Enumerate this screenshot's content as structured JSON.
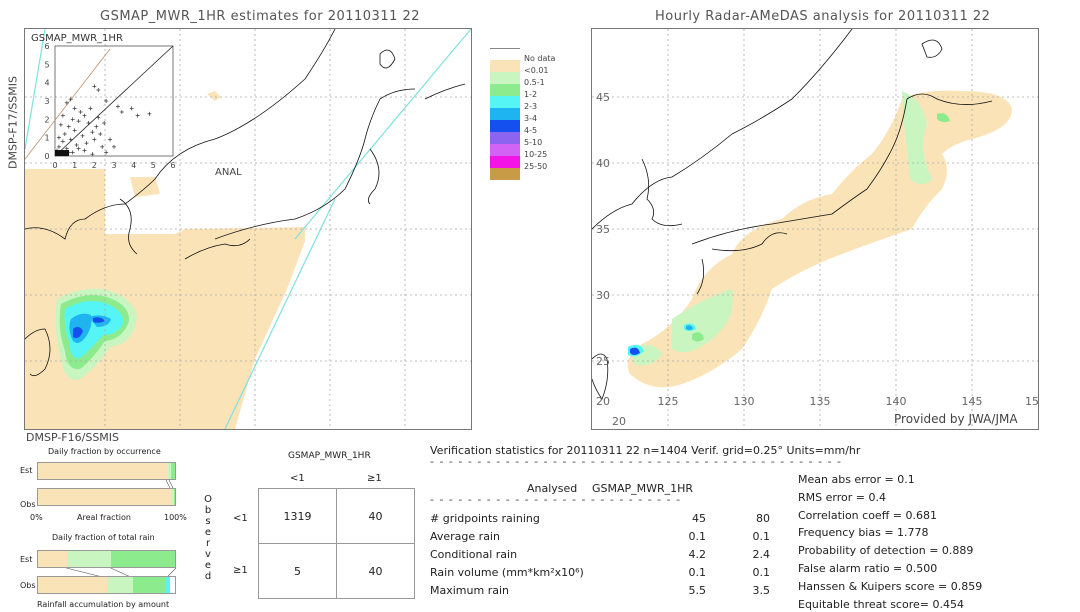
{
  "left_panel": {
    "title": "GSMAP_MWR_1HR estimates for 20110311 22",
    "satellite_top": "DMSP-F17/SSMIS",
    "satellite_bottom": "DMSP-F16/SSMIS",
    "anal_label": "ANAL"
  },
  "right_panel": {
    "title": "Hourly Radar-AMeDAS analysis for 20110311 22",
    "credit": "Provided by JWA/JMA",
    "lat_labels": [
      "45",
      "40",
      "35",
      "30",
      "25",
      "20"
    ],
    "lon_labels": [
      "125",
      "130",
      "135",
      "140",
      "145",
      "15"
    ]
  },
  "legend": [
    {
      "label": "No data",
      "color": "#FFFFFF"
    },
    {
      "label": "<0.01",
      "color": "#FBE3B8"
    },
    {
      "label": "0.5-1",
      "color": "#C8F5C0"
    },
    {
      "label": "1-2",
      "color": "#8CEB8C"
    },
    {
      "label": "2-3",
      "color": "#55F5F5"
    },
    {
      "label": "3-4",
      "color": "#1EB4F0"
    },
    {
      "label": "4-5",
      "color": "#1450F0"
    },
    {
      "label": "5-10",
      "color": "#8C64F0"
    },
    {
      "label": "10-25",
      "color": "#D264F5"
    },
    {
      "label": "25-50",
      "color": "#F514E6"
    },
    {
      "label": "",
      "color": "#C89B46"
    }
  ],
  "chart_data": [
    {
      "type": "scatter",
      "title": "GSMAP_MWR_1HR",
      "xlabel": "ANAL",
      "ylabel": "GSMAP_MWR_1HR",
      "xlim": [
        0,
        6
      ],
      "ylim": [
        0,
        6
      ],
      "x_ticks": [
        "0",
        "1",
        "2",
        "3",
        "4",
        "5",
        "6"
      ],
      "y_ticks": [
        "0",
        "1",
        "2",
        "3",
        "4",
        "5",
        "6"
      ],
      "points": [
        [
          0.1,
          0.3
        ],
        [
          0.2,
          0.5
        ],
        [
          0.3,
          0.2
        ],
        [
          0.4,
          0.8
        ],
        [
          0.5,
          1.2
        ],
        [
          0.6,
          0.4
        ],
        [
          0.7,
          1.6
        ],
        [
          0.8,
          0.9
        ],
        [
          0.9,
          2.0
        ],
        [
          1.0,
          1.4
        ],
        [
          1.1,
          0.6
        ],
        [
          1.2,
          1.9
        ],
        [
          1.3,
          2.4
        ],
        [
          1.4,
          1.1
        ],
        [
          1.5,
          2.2
        ],
        [
          1.6,
          0.7
        ],
        [
          1.7,
          1.8
        ],
        [
          1.8,
          2.6
        ],
        [
          1.9,
          1.3
        ],
        [
          2.0,
          0.9
        ],
        [
          2.1,
          1.6
        ],
        [
          2.2,
          2.1
        ],
        [
          2.3,
          1.2
        ],
        [
          2.4,
          0.5
        ],
        [
          0.2,
          1.0
        ],
        [
          0.4,
          2.2
        ],
        [
          0.6,
          2.9
        ],
        [
          0.8,
          3.1
        ],
        [
          1.0,
          2.6
        ],
        [
          0.3,
          1.7
        ],
        [
          2.5,
          1.8
        ],
        [
          2.8,
          0.9
        ],
        [
          3.2,
          2.7
        ],
        [
          3.4,
          2.4
        ],
        [
          3.9,
          2.6
        ],
        [
          4.2,
          2.2
        ],
        [
          4.8,
          2.3
        ],
        [
          2.6,
          3.0
        ],
        [
          2.2,
          3.6
        ],
        [
          2.0,
          3.8
        ],
        [
          0.5,
          0.1
        ],
        [
          0.9,
          0.2
        ],
        [
          1.5,
          0.3
        ],
        [
          1.9,
          0.1
        ],
        [
          2.6,
          0.2
        ],
        [
          1.2,
          0.4
        ],
        [
          0.2,
          0.1
        ],
        [
          0.1,
          0.1
        ],
        [
          3.0,
          0.5
        ],
        [
          0.7,
          0.2
        ]
      ],
      "reference_lines": [
        "1:1 diagonal",
        "regression line"
      ]
    },
    {
      "type": "bar",
      "title": "Daily fraction by occurrence",
      "xlabel": "Areal fraction",
      "x_ticks": [
        "0%",
        "100%"
      ],
      "categories": [
        "Est",
        "Obs"
      ],
      "series": [
        {
          "name": "<0.01",
          "values": [
            0.95,
            0.98
          ]
        },
        {
          "name": "0.5-1",
          "values": [
            0.02,
            0.01
          ]
        },
        {
          "name": "1-2",
          "values": [
            0.03,
            0.01
          ]
        }
      ]
    },
    {
      "type": "bar",
      "title": "Daily fraction of total rain",
      "xlabel": "Rainfall accumulation by amount",
      "categories": [
        "Est",
        "Obs"
      ],
      "series": [
        {
          "name": "<0.01",
          "values": [
            0.21,
            0.5
          ]
        },
        {
          "name": "0.5-1",
          "values": [
            0.32,
            0.19
          ]
        },
        {
          "name": "1-2",
          "values": [
            0.47,
            0.24
          ]
        },
        {
          "name": "2-3",
          "values": [
            0.0,
            0.03
          ]
        }
      ]
    },
    {
      "type": "table",
      "title": "Contingency table",
      "col_header": "GSMAP_MWR_1HR",
      "row_header": "Observed",
      "columns": [
        "<1",
        "≥1"
      ],
      "rows": [
        "<1",
        "≥1"
      ],
      "cells": [
        [
          "1319",
          "40"
        ],
        [
          "5",
          "40"
        ]
      ]
    }
  ],
  "verification": {
    "header": "Verification statistics for 20110311 22   n=1404   Verif. grid=0.25°   Units=mm/hr",
    "col_analysed": "Analysed",
    "col_gsmap": "GSMAP_MWR_1HR",
    "rows": [
      {
        "label": "# gridpoints raining",
        "analysed": "45",
        "gsmap": "80"
      },
      {
        "label": "Average rain",
        "analysed": "0.1",
        "gsmap": "0.1"
      },
      {
        "label": "Conditional rain",
        "analysed": "4.2",
        "gsmap": "2.4"
      },
      {
        "label": "Rain volume (mm*km²x10⁶)",
        "analysed": "0.1",
        "gsmap": "0.1"
      },
      {
        "label": "Maximum rain",
        "analysed": "5.5",
        "gsmap": "3.5"
      }
    ],
    "scores": [
      "Mean abs error = 0.1",
      "RMS error = 0.4",
      "Correlation coeff = 0.681",
      "Frequency bias = 1.778",
      "Probability of detection = 0.889",
      "False alarm ratio = 0.500",
      "Hanssen & Kuipers score = 0.859",
      "Equitable threat score= 0.454"
    ]
  },
  "occurrence_chart": {
    "title": "Daily fraction by occurrence",
    "est_label": "Est",
    "obs_label": "Obs",
    "x_left": "0%",
    "x_mid": "Areal fraction",
    "x_right": "100%"
  },
  "rain_chart": {
    "title": "Daily fraction of total rain",
    "est_label": "Est",
    "obs_label": "Obs",
    "xlabel": "Rainfall accumulation by amount"
  },
  "contingency": {
    "col_header": "GSMAP_MWR_1HR",
    "col_lt": "<1",
    "col_ge": "≥1",
    "row_lt": "<1",
    "row_ge": "≥1",
    "observed_letters": [
      "O",
      "b",
      "s",
      "e",
      "r",
      "v",
      "e",
      "d"
    ],
    "c11": "1319",
    "c12": "40",
    "c21": "5",
    "c22": "40"
  }
}
